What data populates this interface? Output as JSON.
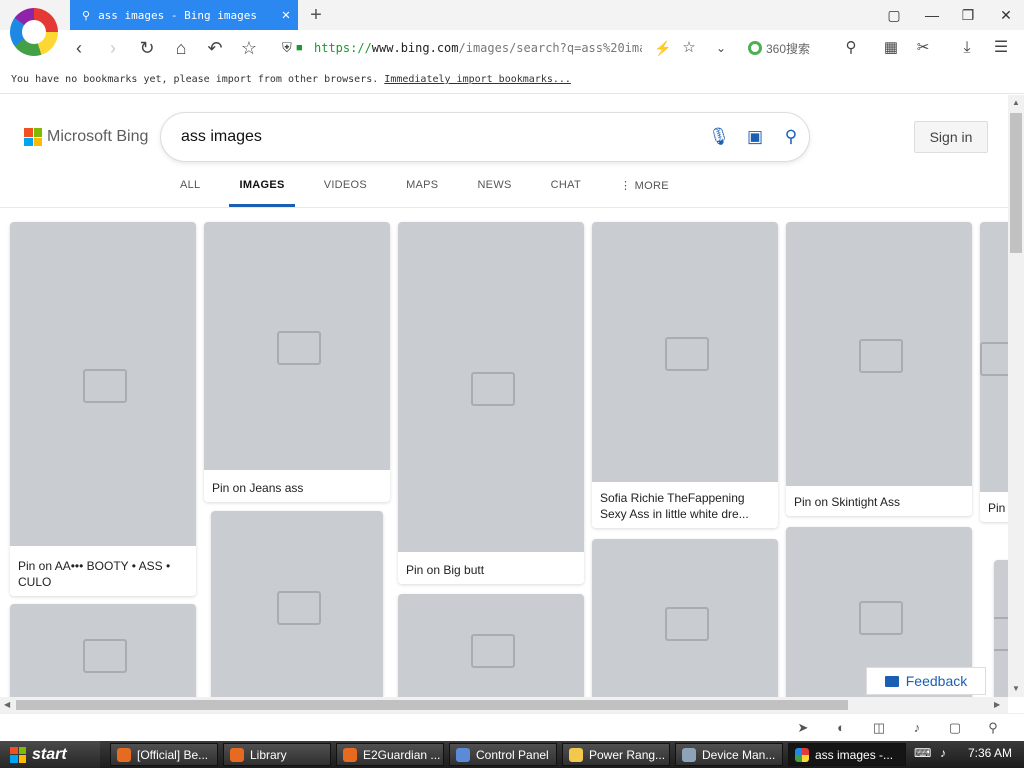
{
  "browser": {
    "tab_title": "ass images - Bing images",
    "tab_icon": "search-icon",
    "url_scheme": "https://",
    "url_host": "www.bing.com",
    "url_path": "/images/search?q=ass%20ima",
    "search_engine": "360搜索",
    "window_buttons": [
      "pin",
      "minimize",
      "restore",
      "close"
    ]
  },
  "bookmarks": {
    "message": "You have no bookmarks yet, please import from other browsers.",
    "import_link": "Immediately import bookmarks..."
  },
  "bing": {
    "brand": "Microsoft Bing",
    "query": "ass images",
    "sign_in": "Sign in",
    "scopes": [
      "ALL",
      "IMAGES",
      "VIDEOS",
      "MAPS",
      "NEWS",
      "CHAT",
      "⋮ MORE"
    ],
    "active_scope": "IMAGES",
    "feedback": "Feedback",
    "colors": {
      "accent": "#1a5fb4",
      "ms_red": "#f25022",
      "ms_green": "#7fba00",
      "ms_blue": "#00a4ef",
      "ms_yellow": "#ffb900"
    }
  },
  "results": [
    {
      "caption": "Pin on AA••• BOOTY • ASS • CULO"
    },
    {
      "caption": "Pin on Jeans ass"
    },
    {
      "caption": "Pin on Big butt"
    },
    {
      "caption": "Sofia Richie TheFappening Sexy Ass in little white dre..."
    },
    {
      "caption": "Pin on Skintight Ass"
    },
    {
      "caption": "Pin"
    }
  ],
  "taskbar": {
    "start": "start",
    "tasks": [
      "[Official] Be...",
      "Library",
      "E2Guardian ...",
      "Control Panel",
      "Power Rang...",
      "Device Man...",
      "ass images -..."
    ],
    "clock": "7:36 AM"
  }
}
